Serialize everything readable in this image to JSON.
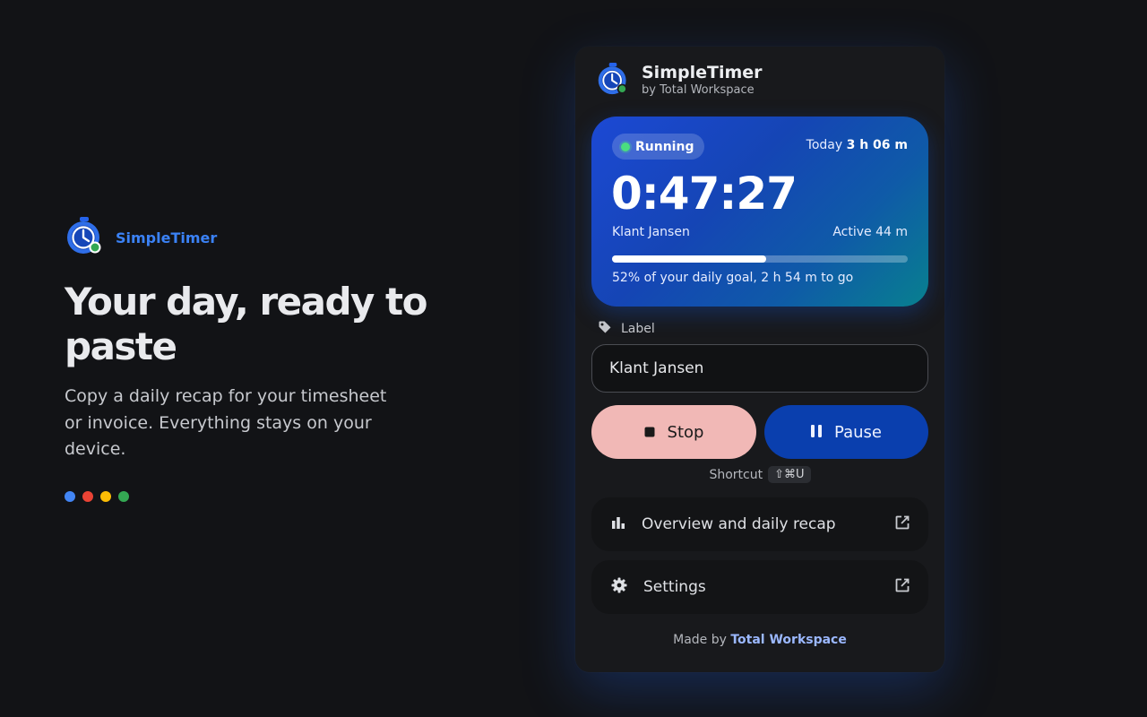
{
  "marketing": {
    "brand_name": "SimpleTimer",
    "headline": "Your day, ready to paste",
    "subtext": "Copy a daily recap for your timesheet or invoice. Everything stays on your device.",
    "dot_colors": [
      "#4285f4",
      "#ea4335",
      "#fbbc05",
      "#34a853"
    ]
  },
  "popup": {
    "app_title": "SimpleTimer",
    "app_subtitle": "by Total Workspace",
    "timer": {
      "status": "Running",
      "today_label": "Today",
      "today_value": "3 h 06 m",
      "elapsed": "0:47:27",
      "client": "Klant Jansen",
      "active": "Active 44 m",
      "goal_progress_percent": 52,
      "goal_text": "52% of your daily goal, 2 h 54 m to go"
    },
    "label_section": {
      "label": "Label",
      "value": "Klant Jansen"
    },
    "buttons": {
      "stop_label": "Stop",
      "pause_label": "Pause"
    },
    "shortcut": {
      "label": "Shortcut",
      "keys": "⇧⌘U"
    },
    "links": {
      "overview_label": "Overview and daily recap",
      "settings_label": "Settings"
    },
    "footer": {
      "prefix": "Made by",
      "link": "Total Workspace"
    }
  },
  "colors": {
    "accent": "#3b82f6",
    "stop_button": "#f1b8b6",
    "pause_button": "#0a3fae",
    "running_dot": "#4ade80"
  }
}
